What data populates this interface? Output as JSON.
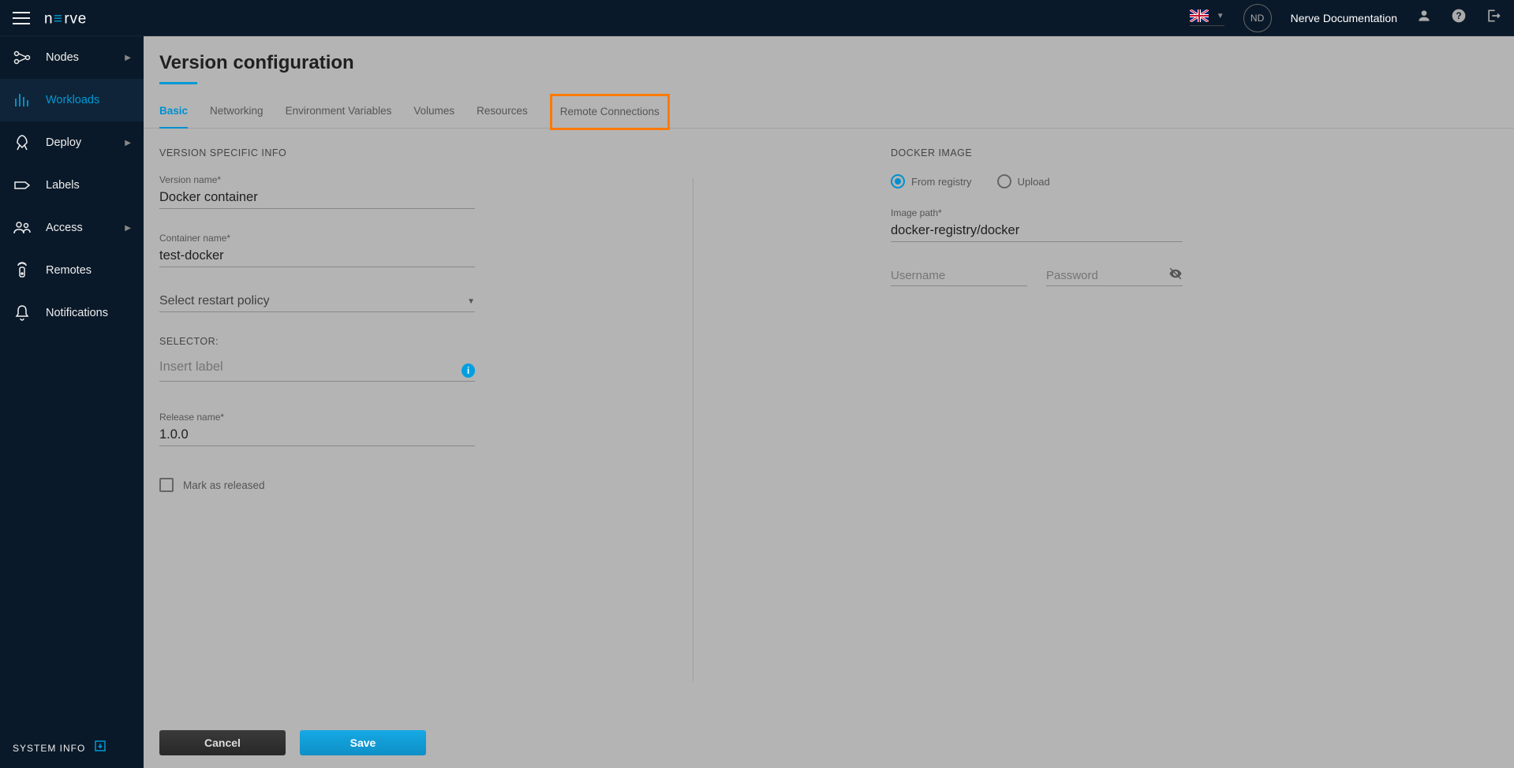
{
  "header": {
    "user_initials": "ND",
    "doc_link": "Nerve Documentation"
  },
  "sidebar": {
    "items": [
      {
        "label": "Nodes",
        "has_chevron": true
      },
      {
        "label": "Workloads",
        "has_chevron": false
      },
      {
        "label": "Deploy",
        "has_chevron": true
      },
      {
        "label": "Labels",
        "has_chevron": false
      },
      {
        "label": "Access",
        "has_chevron": true
      },
      {
        "label": "Remotes",
        "has_chevron": false
      },
      {
        "label": "Notifications",
        "has_chevron": false
      }
    ],
    "footer": "SYSTEM INFO"
  },
  "page": {
    "title": "Version configuration"
  },
  "tabs": [
    {
      "label": "Basic"
    },
    {
      "label": "Networking"
    },
    {
      "label": "Environment Variables"
    },
    {
      "label": "Volumes"
    },
    {
      "label": "Resources"
    },
    {
      "label": "Remote Connections"
    }
  ],
  "form": {
    "left_section": "VERSION SPECIFIC INFO",
    "version_label": "Version name*",
    "version_value": "Docker container",
    "container_label": "Container name*",
    "container_value": "test-docker",
    "restart_placeholder": "Select restart policy",
    "selector_label": "SELECTOR:",
    "selector_placeholder": "Insert label",
    "release_label": "Release name*",
    "release_value": "1.0.0",
    "mark_released": "Mark as released",
    "right_section": "DOCKER IMAGE",
    "radio_registry": "From registry",
    "radio_upload": "Upload",
    "image_label": "Image path*",
    "image_value": "docker-registry/docker",
    "username_placeholder": "Username",
    "password_placeholder": "Password"
  },
  "actions": {
    "cancel": "Cancel",
    "save": "Save"
  }
}
